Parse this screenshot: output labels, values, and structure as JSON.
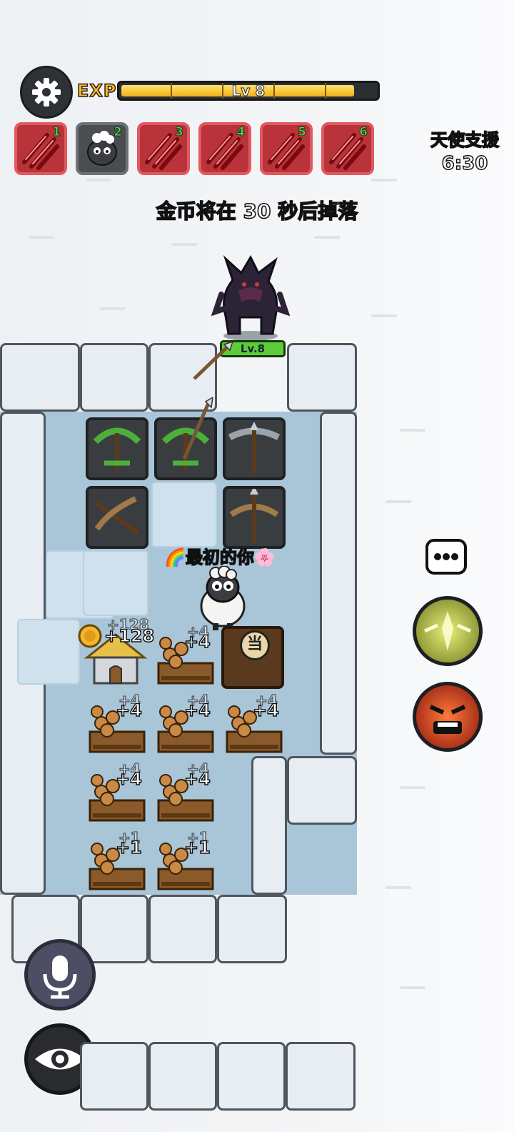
{
  "hud": {
    "settings_icon": "gear-icon",
    "exp_label": "EXP",
    "level_label": "Lv 8",
    "exp_progress_percent": 90
  },
  "slots": [
    {
      "num": "1",
      "type": "claw",
      "state": "red"
    },
    {
      "num": "2",
      "type": "sheep",
      "state": "gray"
    },
    {
      "num": "3",
      "type": "claw",
      "state": "red"
    },
    {
      "num": "4",
      "type": "claw",
      "state": "red"
    },
    {
      "num": "5",
      "type": "claw",
      "state": "red"
    },
    {
      "num": "6",
      "type": "claw",
      "state": "red"
    }
  ],
  "angel_support": {
    "title": "天使支援",
    "time": "6:30"
  },
  "coin_message": "金币将在 30 秒后掉落",
  "monster": {
    "level": "Lv.8",
    "type": "werewolf"
  },
  "player": {
    "name": "🌈最初的你🌸"
  },
  "board": {
    "gold_gain": "+128",
    "gold_gain_shadow": "+128",
    "shop_sign": "当",
    "wood_gains": [
      {
        "main": "+4",
        "shadow": "+4"
      },
      {
        "main": "+4",
        "shadow": "+4"
      },
      {
        "main": "+4",
        "shadow": "+4"
      },
      {
        "main": "+4",
        "shadow": "+4"
      },
      {
        "main": "+4",
        "shadow": "+4"
      },
      {
        "main": "+4",
        "shadow": "+4"
      },
      {
        "main": "+1",
        "shadow": "+1"
      },
      {
        "main": "+1",
        "shadow": "+1"
      }
    ]
  },
  "side_buttons": {
    "chat": "chat-bubble-icon",
    "skill_1": "angel-power-icon",
    "skill_2": "rage-face-icon",
    "mic": "microphone-icon",
    "view": "eye-icon"
  },
  "colors": {
    "exp_fill": "#f1b21c",
    "slot_red": "#b8333a",
    "level_green": "#5ecb3a"
  }
}
